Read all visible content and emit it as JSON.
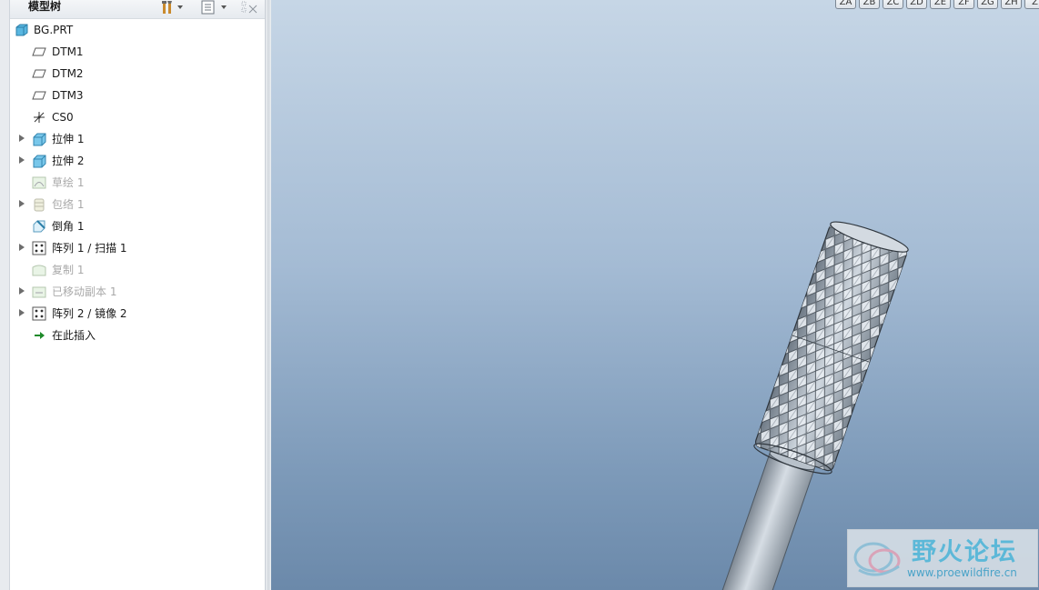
{
  "model_tree": {
    "title": "模型树",
    "items": [
      {
        "label": "BG.PRT",
        "icon": "part-icon",
        "expandable": false,
        "dimmed": false
      },
      {
        "label": "DTM1",
        "icon": "datum-plane-icon",
        "expandable": false,
        "dimmed": false
      },
      {
        "label": "DTM2",
        "icon": "datum-plane-icon",
        "expandable": false,
        "dimmed": false
      },
      {
        "label": "DTM3",
        "icon": "datum-plane-icon",
        "expandable": false,
        "dimmed": false
      },
      {
        "label": "CS0",
        "icon": "coordinate-system-icon",
        "expandable": false,
        "dimmed": false
      },
      {
        "label": "拉伸 1",
        "icon": "extrude-icon",
        "expandable": true,
        "dimmed": false
      },
      {
        "label": "拉伸 2",
        "icon": "extrude-icon",
        "expandable": true,
        "dimmed": false
      },
      {
        "label": "草绘 1",
        "icon": "sketch-icon",
        "expandable": false,
        "dimmed": true
      },
      {
        "label": "包络 1",
        "icon": "wrap-icon",
        "expandable": true,
        "dimmed": true
      },
      {
        "label": "倒角 1",
        "icon": "chamfer-icon",
        "expandable": false,
        "dimmed": false
      },
      {
        "label": "阵列 1 / 扫描 1",
        "icon": "pattern-icon",
        "expandable": true,
        "dimmed": false
      },
      {
        "label": "复制 1",
        "icon": "copy-icon",
        "expandable": false,
        "dimmed": true
      },
      {
        "label": "已移动副本 1",
        "icon": "moved-copy-icon",
        "expandable": true,
        "dimmed": true
      },
      {
        "label": "阵列 2 / 镜像 2",
        "icon": "pattern-icon",
        "expandable": true,
        "dimmed": false
      },
      {
        "label": "在此插入",
        "icon": "insert-here-icon",
        "expandable": false,
        "dimmed": false
      }
    ]
  },
  "view_toolbar": {
    "buttons": [
      "ZA",
      "ZB",
      "ZC",
      "ZD",
      "ZE",
      "ZF",
      "ZG",
      "ZH",
      "Z"
    ]
  },
  "watermark": {
    "title": "野火论坛",
    "url": "www.proewildfire.cn"
  },
  "colors": {
    "viewport_top": "#c6d6e6",
    "viewport_bottom": "#6b89aa",
    "model_grey": "#9aa4ae",
    "watermark_text": "#5cb8d8"
  }
}
